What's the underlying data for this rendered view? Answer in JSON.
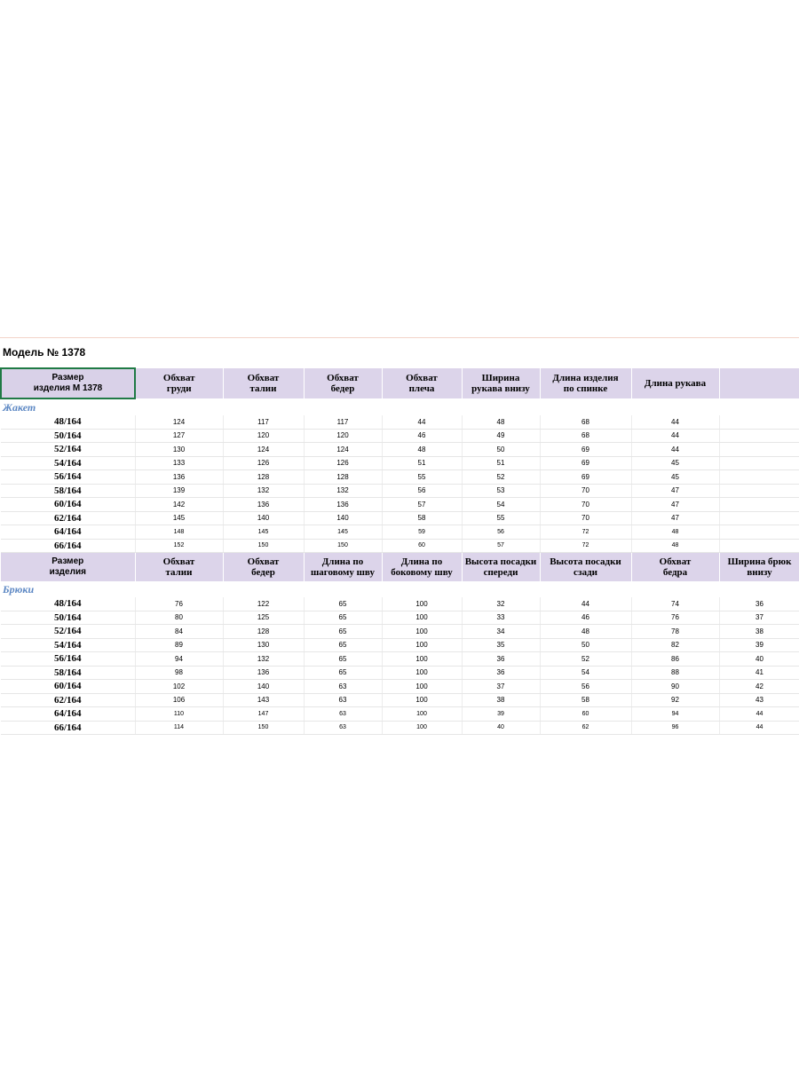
{
  "model_title": "Модель №  1378",
  "jacket": {
    "section_label": "Жакет",
    "headers": [
      "Размер\nизделия М 1378",
      "Обхват\nгруди",
      "Обхват\nталии",
      "Обхват\nбедер",
      "Обхват\nплеча",
      "Ширина\nрукава внизу",
      "Длина изделия\nпо спинке",
      "Длина рукава",
      ""
    ],
    "rows": [
      [
        "48/164",
        "124",
        "117",
        "117",
        "44",
        "48",
        "68",
        "44",
        ""
      ],
      [
        "50/164",
        "127",
        "120",
        "120",
        "46",
        "49",
        "68",
        "44",
        ""
      ],
      [
        "52/164",
        "130",
        "124",
        "124",
        "48",
        "50",
        "69",
        "44",
        ""
      ],
      [
        "54/164",
        "133",
        "126",
        "126",
        "51",
        "51",
        "69",
        "45",
        ""
      ],
      [
        "56/164",
        "136",
        "128",
        "128",
        "55",
        "52",
        "69",
        "45",
        ""
      ],
      [
        "58/164",
        "139",
        "132",
        "132",
        "56",
        "53",
        "70",
        "47",
        ""
      ],
      [
        "60/164",
        "142",
        "136",
        "136",
        "57",
        "54",
        "70",
        "47",
        ""
      ],
      [
        "62/164",
        "145",
        "140",
        "140",
        "58",
        "55",
        "70",
        "47",
        ""
      ],
      [
        "64/164",
        "148",
        "145",
        "145",
        "59",
        "56",
        "72",
        "48",
        ""
      ],
      [
        "66/164",
        "152",
        "150",
        "150",
        "60",
        "57",
        "72",
        "48",
        ""
      ]
    ]
  },
  "trousers": {
    "section_label": "Брюки",
    "headers": [
      "Размер\nизделия",
      "Обхват\nталии",
      "Обхват\nбедер",
      "Длина по\nшаговому шву",
      "Длина по\nбоковому шву",
      "Высота посадки\nспереди",
      "Высота посадки\nсзади",
      "Обхват\nбедра",
      "Ширина брюк\nвнизу"
    ],
    "rows": [
      [
        "48/164",
        "76",
        "122",
        "65",
        "100",
        "32",
        "44",
        "74",
        "36"
      ],
      [
        "50/164",
        "80",
        "125",
        "65",
        "100",
        "33",
        "46",
        "76",
        "37"
      ],
      [
        "52/164",
        "84",
        "128",
        "65",
        "100",
        "34",
        "48",
        "78",
        "38"
      ],
      [
        "54/164",
        "89",
        "130",
        "65",
        "100",
        "35",
        "50",
        "82",
        "39"
      ],
      [
        "56/164",
        "94",
        "132",
        "65",
        "100",
        "36",
        "52",
        "86",
        "40"
      ],
      [
        "58/164",
        "98",
        "136",
        "65",
        "100",
        "36",
        "54",
        "88",
        "41"
      ],
      [
        "60/164",
        "102",
        "140",
        "63",
        "100",
        "37",
        "56",
        "90",
        "42"
      ],
      [
        "62/164",
        "106",
        "143",
        "63",
        "100",
        "38",
        "58",
        "92",
        "43"
      ],
      [
        "64/164",
        "110",
        "147",
        "63",
        "100",
        "39",
        "60",
        "94",
        "44"
      ],
      [
        "66/164",
        "114",
        "150",
        "63",
        "100",
        "40",
        "62",
        "96",
        "44"
      ]
    ]
  },
  "colors": {
    "header_bg": "#dcd4ea",
    "section_label": "#5d88c4",
    "selected_cell_border": "#1f7a45"
  }
}
